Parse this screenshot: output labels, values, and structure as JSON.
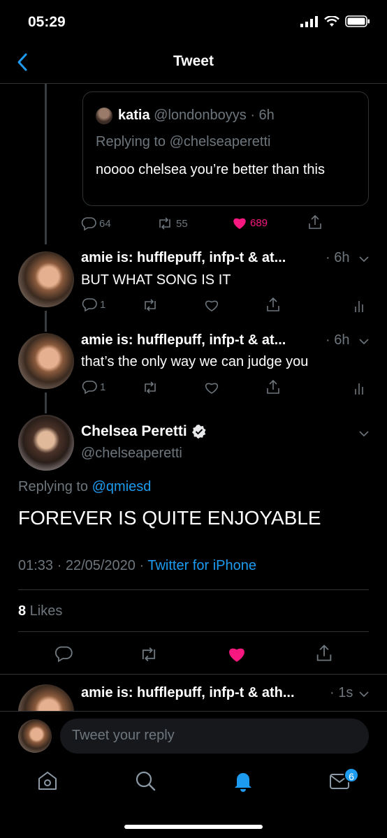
{
  "status": {
    "time": "05:29"
  },
  "header": {
    "title": "Tweet"
  },
  "quoted": {
    "name": "katia",
    "handle": "@londonboyys · 6h",
    "replying": "Replying to @chelseaperetti",
    "text": "noooo chelsea you’re better than this",
    "stats": {
      "replies": "64",
      "retweets": "55",
      "likes": "689"
    }
  },
  "replies": [
    {
      "name": "amie is: hufflepuff, infp-t & at...",
      "time": "· 6h",
      "text": "BUT WHAT SONG IS IT",
      "reply_count": "1"
    },
    {
      "name": "amie is: hufflepuff, infp-t & at...",
      "time": "· 6h",
      "text": "that’s the only way we can judge you",
      "reply_count": "1"
    }
  ],
  "main": {
    "name": "Chelsea Peretti",
    "handle": "@chelseaperetti",
    "replying_prefix": "Replying to ",
    "replying_to": "@qmiesd",
    "text": "FOREVER IS QUITE ENJOYABLE",
    "timestamp": "01:33 · 22/05/2020 · ",
    "source": "Twitter for iPhone",
    "likes_count": "8",
    "likes_label": " Likes"
  },
  "next_reply": {
    "name": "amie is: hufflepuff, infp-t & ath...",
    "time": "· 1s"
  },
  "composer": {
    "placeholder": "Tweet your reply"
  },
  "tabbar": {
    "badge": "6"
  },
  "colors": {
    "accent": "#1d9bf0",
    "like": "#f91880",
    "background": "#000000"
  }
}
